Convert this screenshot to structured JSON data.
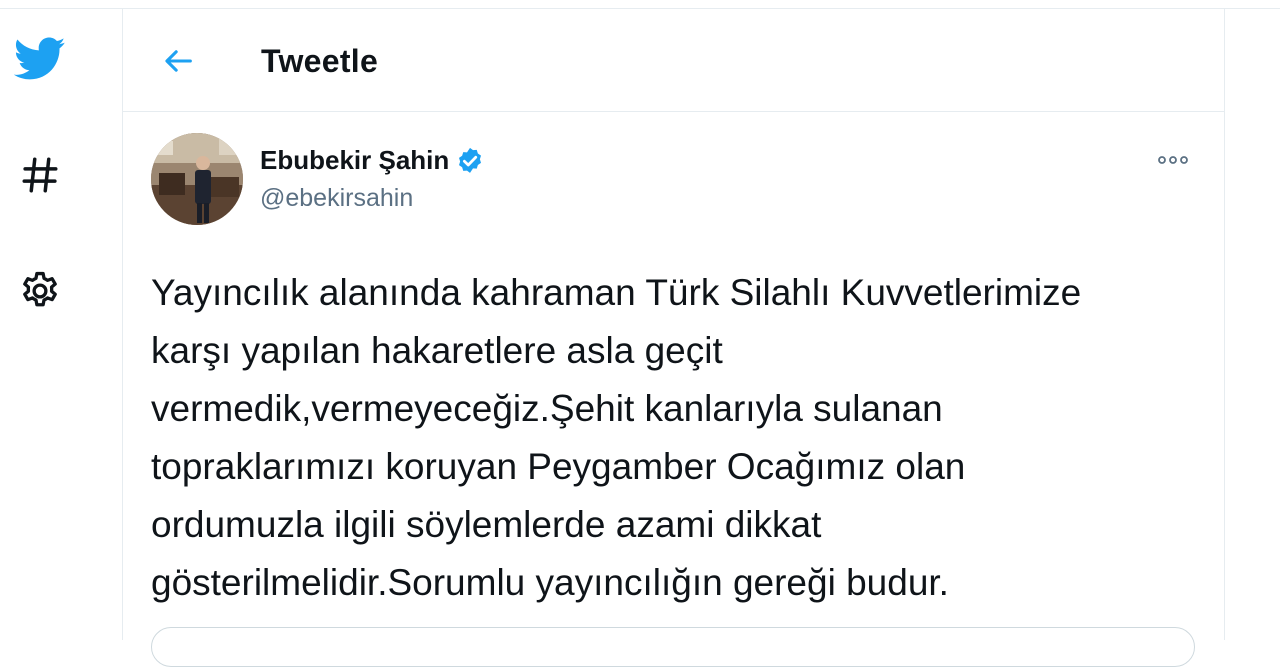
{
  "header": {
    "title": "Tweetle"
  },
  "nav": {
    "items": [
      {
        "icon": "twitter-logo-icon"
      },
      {
        "icon": "hashtag-icon"
      },
      {
        "icon": "gear-icon"
      }
    ]
  },
  "tweet": {
    "author_name": "Ebubekir Şahin",
    "author_handle": "@ebekirsahin",
    "verified": true,
    "text_lines": [
      "Yayıncılık alanında kahraman Türk Silahlı Kuvvetlerimize",
      "karşı yapılan hakaretlere asla geçit",
      "vermedik,vermeyeceğiz.Şehit kanlarıyla sulanan",
      "topraklarımızı koruyan Peygamber Ocağımız olan",
      "ordumuzla ilgili söylemlerde azami dikkat",
      "gösterilmelidir.Sorumlu yayıncılığın gereği budur."
    ]
  },
  "colors": {
    "accent": "#1da1f2",
    "text": "#0f1419",
    "secondary_text": "#5b7083",
    "border": "#e6ecf0"
  }
}
